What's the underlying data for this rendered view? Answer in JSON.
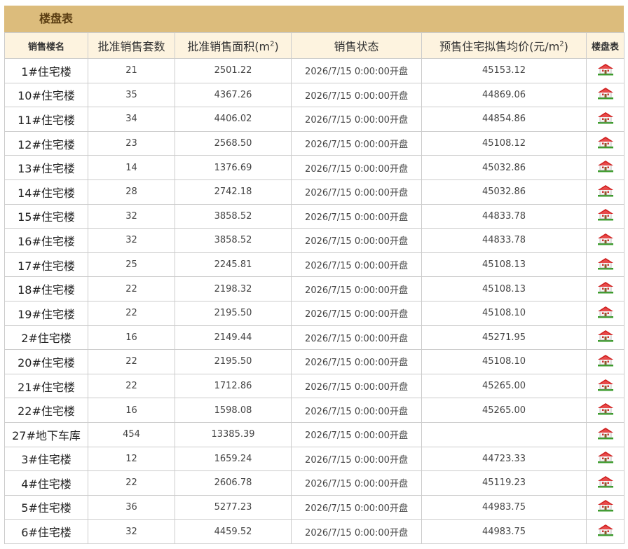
{
  "title": "楼盘表",
  "headers": {
    "name": "销售楼名",
    "units": "批准销售套数",
    "area_prefix": "批准销售面积(m",
    "area_sup": "2",
    "area_suffix": ")",
    "status": "销售状态",
    "price_prefix": "预售住宅拟售均价(元/m",
    "price_sup": "2",
    "price_suffix": ")",
    "plan": "楼盘表"
  },
  "icon": "house-icon",
  "colors": {
    "title_bg": "#dcbc7c",
    "header_bg": "#fdf3df",
    "roof": "#d32222",
    "grass": "#3a9b2a"
  },
  "rows": [
    {
      "name": "1#住宅楼",
      "units": "21",
      "area": "2501.22",
      "status": "2026/7/15 0:00:00开盘",
      "price": "45153.12"
    },
    {
      "name": "10#住宅楼",
      "units": "35",
      "area": "4367.26",
      "status": "2026/7/15 0:00:00开盘",
      "price": "44869.06"
    },
    {
      "name": "11#住宅楼",
      "units": "34",
      "area": "4406.02",
      "status": "2026/7/15 0:00:00开盘",
      "price": "44854.86"
    },
    {
      "name": "12#住宅楼",
      "units": "23",
      "area": "2568.50",
      "status": "2026/7/15 0:00:00开盘",
      "price": "45108.12"
    },
    {
      "name": "13#住宅楼",
      "units": "14",
      "area": "1376.69",
      "status": "2026/7/15 0:00:00开盘",
      "price": "45032.86"
    },
    {
      "name": "14#住宅楼",
      "units": "28",
      "area": "2742.18",
      "status": "2026/7/15 0:00:00开盘",
      "price": "45032.86"
    },
    {
      "name": "15#住宅楼",
      "units": "32",
      "area": "3858.52",
      "status": "2026/7/15 0:00:00开盘",
      "price": "44833.78"
    },
    {
      "name": "16#住宅楼",
      "units": "32",
      "area": "3858.52",
      "status": "2026/7/15 0:00:00开盘",
      "price": "44833.78"
    },
    {
      "name": "17#住宅楼",
      "units": "25",
      "area": "2245.81",
      "status": "2026/7/15 0:00:00开盘",
      "price": "45108.13"
    },
    {
      "name": "18#住宅楼",
      "units": "22",
      "area": "2198.32",
      "status": "2026/7/15 0:00:00开盘",
      "price": "45108.13"
    },
    {
      "name": "19#住宅楼",
      "units": "22",
      "area": "2195.50",
      "status": "2026/7/15 0:00:00开盘",
      "price": "45108.10"
    },
    {
      "name": "2#住宅楼",
      "units": "16",
      "area": "2149.44",
      "status": "2026/7/15 0:00:00开盘",
      "price": "45271.95"
    },
    {
      "name": "20#住宅楼",
      "units": "22",
      "area": "2195.50",
      "status": "2026/7/15 0:00:00开盘",
      "price": "45108.10"
    },
    {
      "name": "21#住宅楼",
      "units": "22",
      "area": "1712.86",
      "status": "2026/7/15 0:00:00开盘",
      "price": "45265.00"
    },
    {
      "name": "22#住宅楼",
      "units": "16",
      "area": "1598.08",
      "status": "2026/7/15 0:00:00开盘",
      "price": "45265.00"
    },
    {
      "name": "27#地下车库",
      "units": "454",
      "area": "13385.39",
      "status": "2026/7/15 0:00:00开盘",
      "price": ""
    },
    {
      "name": "3#住宅楼",
      "units": "12",
      "area": "1659.24",
      "status": "2026/7/15 0:00:00开盘",
      "price": "44723.33"
    },
    {
      "name": "4#住宅楼",
      "units": "22",
      "area": "2606.78",
      "status": "2026/7/15 0:00:00开盘",
      "price": "45119.23"
    },
    {
      "name": "5#住宅楼",
      "units": "36",
      "area": "5277.23",
      "status": "2026/7/15 0:00:00开盘",
      "price": "44983.75"
    },
    {
      "name": "6#住宅楼",
      "units": "32",
      "area": "4459.52",
      "status": "2026/7/15 0:00:00开盘",
      "price": "44983.75"
    }
  ]
}
